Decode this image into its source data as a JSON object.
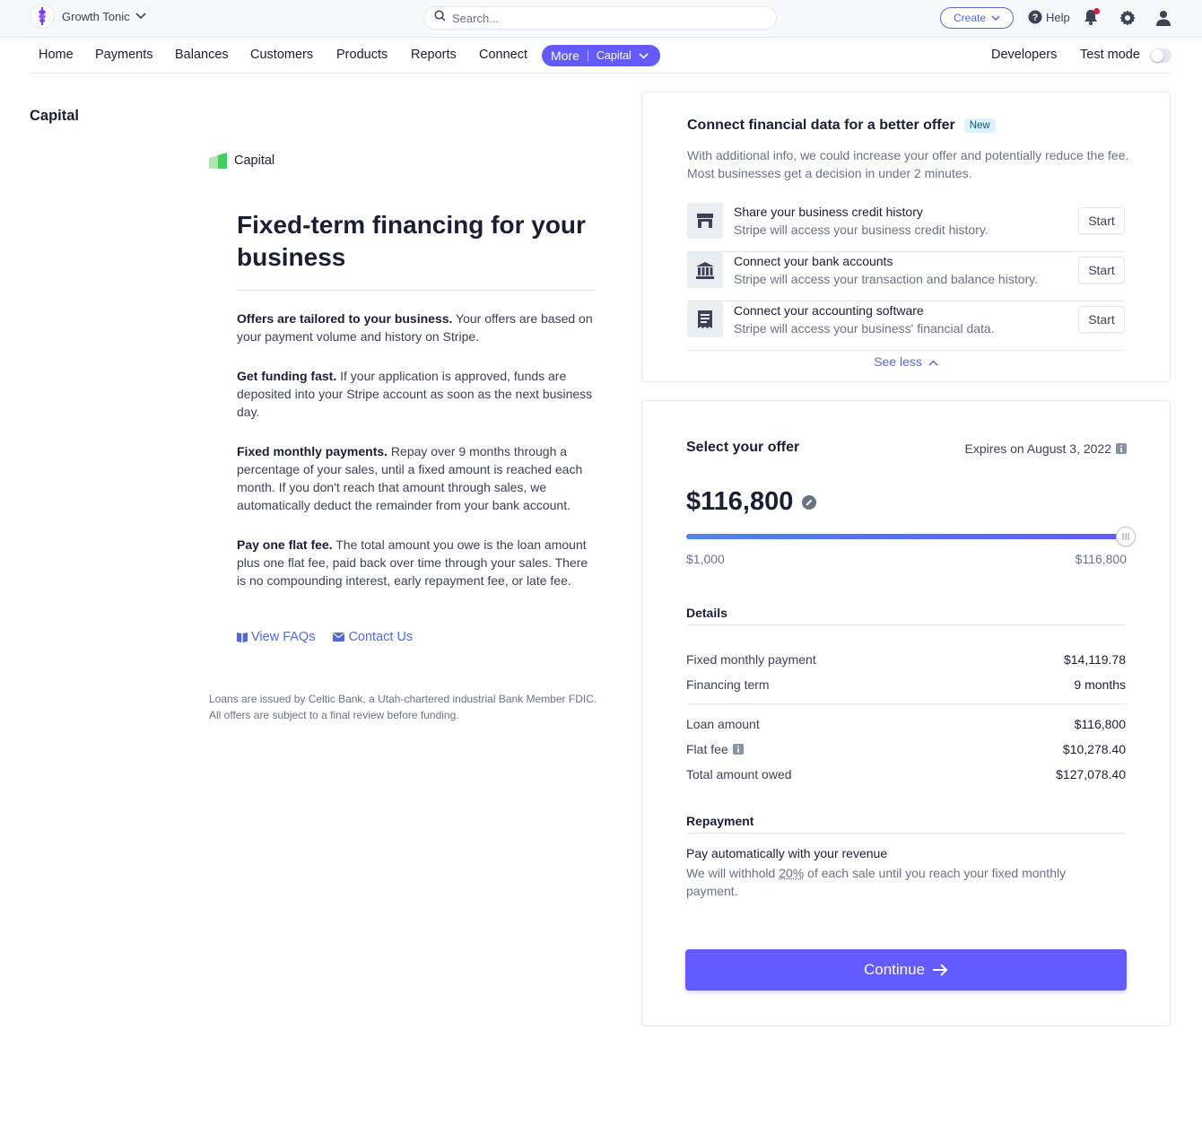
{
  "topbar": {
    "account_name": "Growth Tonic",
    "search_placeholder": "Search...",
    "create_label": "Create",
    "help_label": "Help"
  },
  "nav": {
    "items": [
      "Home",
      "Payments",
      "Balances",
      "Customers",
      "Products",
      "Reports",
      "Connect"
    ],
    "more_label": "More",
    "more_current": "Capital",
    "developers_label": "Developers",
    "test_mode_label": "Test mode",
    "test_mode_on": false
  },
  "page": {
    "title": "Capital"
  },
  "left": {
    "brand_label": "Capital",
    "headline": "Fixed-term financing for your business",
    "paragraphs": [
      {
        "bold": "Offers are tailored to your business.",
        "text": " Your offers are based on your payment volume and history on Stripe."
      },
      {
        "bold": "Get funding fast.",
        "text": " If your application is approved, funds are deposited into your Stripe account as soon as the next business day."
      },
      {
        "bold": "Fixed monthly payments.",
        "text": " Repay over 9 months through a percentage of your sales, until a fixed amount is reached each month. If you don't reach that amount through sales, we automatically deduct the remainder from your bank account."
      },
      {
        "bold": "Pay one flat fee.",
        "text": " The total amount you owe is the loan amount plus one flat fee, paid back over time through your sales. There is no compounding interest, early repayment fee, or late fee."
      }
    ],
    "faq_link": "View FAQs",
    "contact_link": "Contact Us",
    "legal_line1": "Loans are issued by Celtic Bank, a Utah-chartered industrial Bank Member FDIC.",
    "legal_line2": "All offers are subject to a final review before funding."
  },
  "connect_card": {
    "title": "Connect financial data for a better offer",
    "badge": "New",
    "description": "With additional info, we could increase your offer and potentially reduce the fee. Most businesses get a decision in under 2 minutes.",
    "rows": [
      {
        "icon": "storefront-icon",
        "title": "Share your business credit history",
        "subtitle": "Stripe will access your business credit history.",
        "button": "Start"
      },
      {
        "icon": "bank-icon",
        "title": "Connect your bank accounts",
        "subtitle": "Stripe will access your transaction and balance history.",
        "button": "Start"
      },
      {
        "icon": "receipt-icon",
        "title": "Connect your accounting software",
        "subtitle": "Stripe will access your business' financial data.",
        "button": "Start"
      }
    ],
    "see_less": "See less"
  },
  "offer_card": {
    "title": "Select your offer",
    "expires": "Expires on August 3, 2022",
    "amount": "$116,800",
    "slider": {
      "min_label": "$1,000",
      "max_label": "$116,800",
      "value_fraction": 1.0
    },
    "details_heading": "Details",
    "details": [
      {
        "label": "Fixed monthly payment",
        "value": "$14,119.78"
      },
      {
        "label": "Financing term",
        "value": "9 months"
      },
      {
        "label": "Loan amount",
        "value": "$116,800"
      },
      {
        "label": "Flat fee",
        "value": "$10,278.40"
      },
      {
        "label": "Total amount owed",
        "value": "$127,078.40"
      }
    ],
    "repayment_heading": "Repayment",
    "repayment_title": "Pay automatically with your revenue",
    "repayment_pre": "We will withhold ",
    "repayment_pct": "20%",
    "repayment_post": " of each sale until you reach your fixed monthly payment.",
    "continue_label": "Continue"
  },
  "colors": {
    "accent": "#635bff",
    "link": "#5469d4",
    "brand_green": "#3ecf5c"
  }
}
